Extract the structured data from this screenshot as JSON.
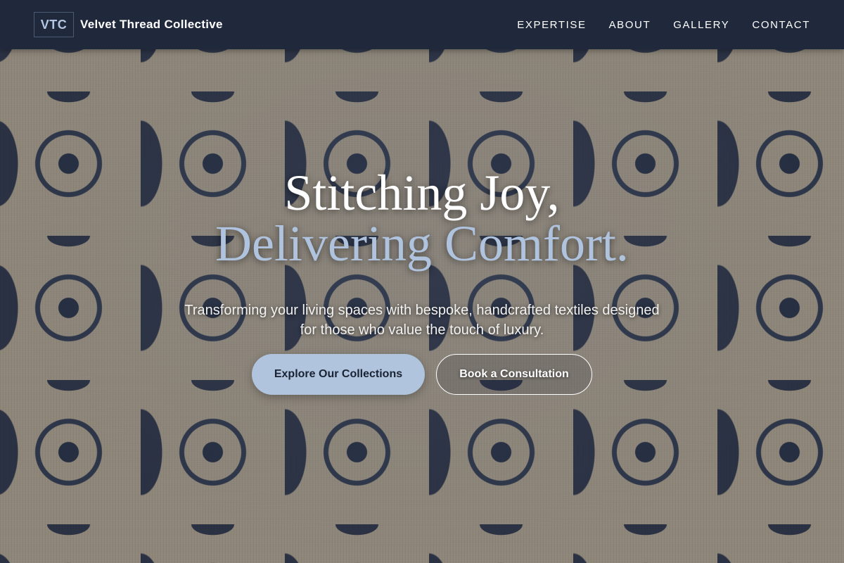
{
  "header": {
    "logo_text": "VTC",
    "brand_name": "Velvet Thread Collective",
    "nav": [
      "EXPERTISE",
      "ABOUT",
      "GALLERY",
      "CONTACT"
    ]
  },
  "hero": {
    "title_line1": "Stitching Joy,",
    "title_line2": "Delivering Comfort.",
    "subtitle": "Transforming your living spaces with bespoke, handcrafted textiles designed for those who value the touch of luxury.",
    "primary_button": "Explore Our Collections",
    "secondary_button": "Book a Consultation"
  },
  "colors": {
    "header_bg": "#1f293b",
    "accent": "#b0c4de",
    "pattern_dark": "#1e2a44",
    "pattern_light": "#a39886"
  }
}
